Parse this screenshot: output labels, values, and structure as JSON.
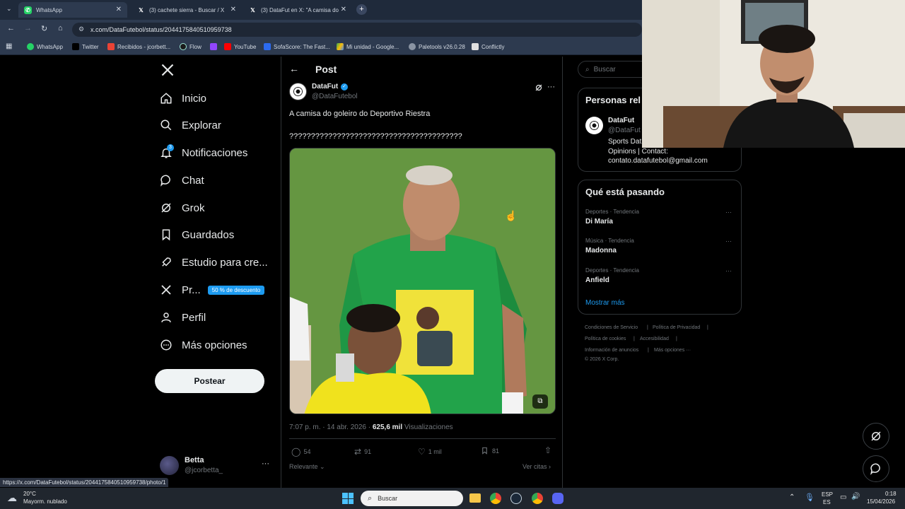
{
  "browser": {
    "tabs": [
      {
        "label": "WhatsApp",
        "icon": "whatsapp-icon"
      },
      {
        "label": "(3) cachete sierra - Buscar / X",
        "icon": "x-logo-icon"
      },
      {
        "label": "(3) DataFut en X: \"A camisa do",
        "icon": "x-logo-icon"
      }
    ],
    "url": "x.com/DataFutebol/status/2044175840510959738",
    "bookmarks": [
      "WhatsApp",
      "Twitter",
      "Recibidos - jcorbett...",
      "Flow",
      "",
      "YouTube",
      "SofaScore: The Fast...",
      "Mi unidad - Google...",
      "Paletools v26.0.28",
      "Conflictly"
    ],
    "status_url": "https://x.com/DataFutebol/status/2044175840510959738/photo/1"
  },
  "nav": {
    "items": [
      "Inicio",
      "Explorar",
      "Notificaciones",
      "Chat",
      "Grok",
      "Guardados",
      "Estudio para cre...",
      "Pr...",
      "Perfil",
      "Más opciones"
    ],
    "notifications_badge": "3",
    "promo_badge": "50 % de descuento",
    "post_button": "Postear",
    "account_name": "Betta",
    "account_handle": "@jcorbetta_",
    "more_glyph": "···"
  },
  "post": {
    "header": "Post",
    "author_name": "DataFut",
    "author_handle": "@DataFutebol",
    "text": "A camisa do goleiro do Deportivo Riestra",
    "text2": "????????????????????????????????????????",
    "timestamp": "7:07 p. m. · 14 abr. 2026 · ",
    "views": "625,6 mil",
    "views_label": " Visualizaciones",
    "replies": "54",
    "reposts": "91",
    "likes": "1 mil",
    "bookmarks": "81",
    "relevant": "Relevante",
    "quotes": "Ver citas"
  },
  "sidebar": {
    "search_placeholder": "Buscar",
    "people_title": "Personas rel",
    "person_name": "DataFut",
    "person_handle": "@DataFut",
    "person_bio_1": "Sports Dat",
    "person_bio_2": "Opinions | Contact:",
    "person_bio_3": "contato.datafutebol@gmail.com",
    "trends_title": "Qué está pasando",
    "trends": [
      {
        "category": "Deportes · Tendencia",
        "name": "Di María"
      },
      {
        "category": "Música · Tendencia",
        "name": "Madonna"
      },
      {
        "category": "Deportes · Tendencia",
        "name": "Anfield"
      }
    ],
    "show_more": "Mostrar más",
    "footer": [
      "Condiciones de Servicio",
      "Política de Privacidad",
      "Política de cookies",
      "Accesibilidad",
      "Información de anuncios",
      "Más opciones ···",
      "© 2026 X Corp."
    ]
  },
  "taskbar": {
    "weather_temp": "20°C",
    "weather_desc": "Mayorm. nublado",
    "search": "Buscar",
    "lang1": "ESP",
    "lang2": "ES",
    "time": "0:18",
    "date": "15/04/2026"
  },
  "colors": {
    "accent": "#1d9bf0",
    "background": "#000000",
    "text": "#e7e9ea",
    "muted": "#71767b"
  }
}
